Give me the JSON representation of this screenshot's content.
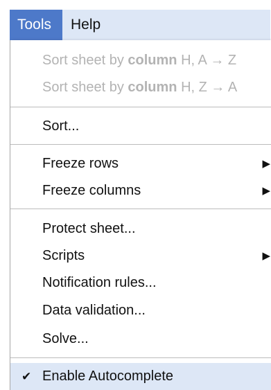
{
  "menubar": {
    "tools_label": "Tools",
    "help_label": "Help"
  },
  "menu": {
    "sort_az_prefix": "Sort sheet by ",
    "sort_az_bold": "column",
    "sort_az_suffix": " H, A → Z",
    "sort_za_prefix": "Sort sheet by ",
    "sort_za_bold": "column",
    "sort_za_suffix": " H, Z → A",
    "sort": "Sort...",
    "freeze_rows": "Freeze rows",
    "freeze_columns": "Freeze columns",
    "protect_sheet": "Protect sheet...",
    "scripts": "Scripts",
    "notification_rules": "Notification rules...",
    "data_validation": "Data validation...",
    "solve": "Solve...",
    "enable_autocomplete": "Enable Autocomplete",
    "submenu_arrow": "▶",
    "checkmark": "✔"
  },
  "colors": {
    "active_tab": "#4d79c9",
    "menubar_bg": "#dde7f6",
    "disabled_text": "#b3b3b3",
    "background_graphic": "#f5c7c7"
  }
}
